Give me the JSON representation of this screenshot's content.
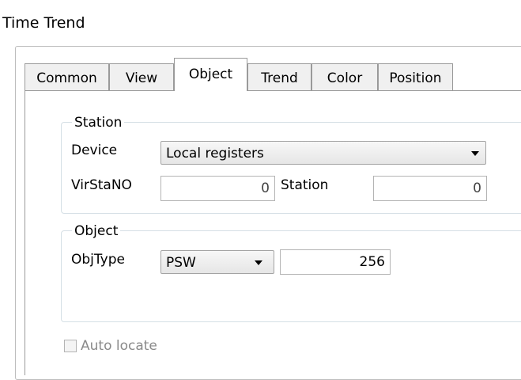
{
  "window": {
    "title": "Time Trend"
  },
  "tabs": [
    {
      "label": "Common"
    },
    {
      "label": "View"
    },
    {
      "label": "Object"
    },
    {
      "label": "Trend"
    },
    {
      "label": "Color"
    },
    {
      "label": "Position"
    }
  ],
  "active_tab": "Object",
  "station_group": {
    "legend": "Station",
    "device_label": "Device",
    "device_value": "Local registers",
    "virstano_label": "VirStaNO",
    "virstano_value": "0",
    "station_label": "Station",
    "station_value": "0"
  },
  "object_group": {
    "legend": "Object",
    "objtype_label": "ObjType",
    "objtype_value": "PSW",
    "address_value": "256"
  },
  "auto_locate": {
    "label": "Auto locate",
    "checked": false
  }
}
